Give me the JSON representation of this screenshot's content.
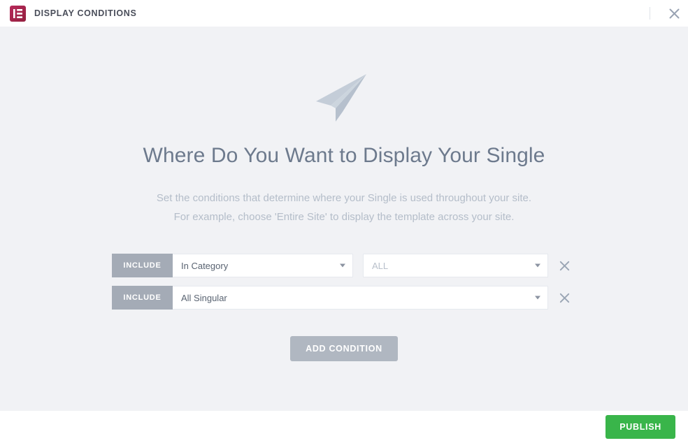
{
  "header": {
    "logo_icon": "elementor-logo-icon",
    "title": "DISPLAY CONDITIONS",
    "close_icon": "close-icon",
    "brand_gradient_start": "#b7295a",
    "brand_gradient_end": "#93203f"
  },
  "main": {
    "hero_icon": "paper-plane-icon",
    "headline": "Where Do You Want to Display Your Single",
    "subtext_line_1": "Set the conditions that determine where your Single is used throughout your site.",
    "subtext_line_2": "For example, choose 'Entire Site' to display the template across your site.",
    "background_color": "#f1f2f5",
    "headline_color": "#6d7a8d",
    "subtext_color": "#b4bdc9"
  },
  "conditions": {
    "rows": [
      {
        "include_label": "INCLUDE",
        "type_value": "In Category",
        "type_caret_icon": "chevron-down-icon",
        "sub_value": "ALL",
        "sub_is_placeholder": true,
        "sub_caret_icon": "chevron-down-icon",
        "remove_icon": "close-icon",
        "has_sub_select": true
      },
      {
        "include_label": "INCLUDE",
        "type_value": "All Singular",
        "type_caret_icon": "chevron-down-icon",
        "sub_value": "",
        "sub_is_placeholder": false,
        "sub_caret_icon": "chevron-down-icon",
        "remove_icon": "close-icon",
        "has_sub_select": false
      }
    ],
    "add_condition_label": "ADD CONDITION",
    "include_button_color": "#a4abb6",
    "add_condition_color": "#b0b7c1"
  },
  "footer": {
    "publish_label": "PUBLISH",
    "publish_color": "#39b54a"
  }
}
